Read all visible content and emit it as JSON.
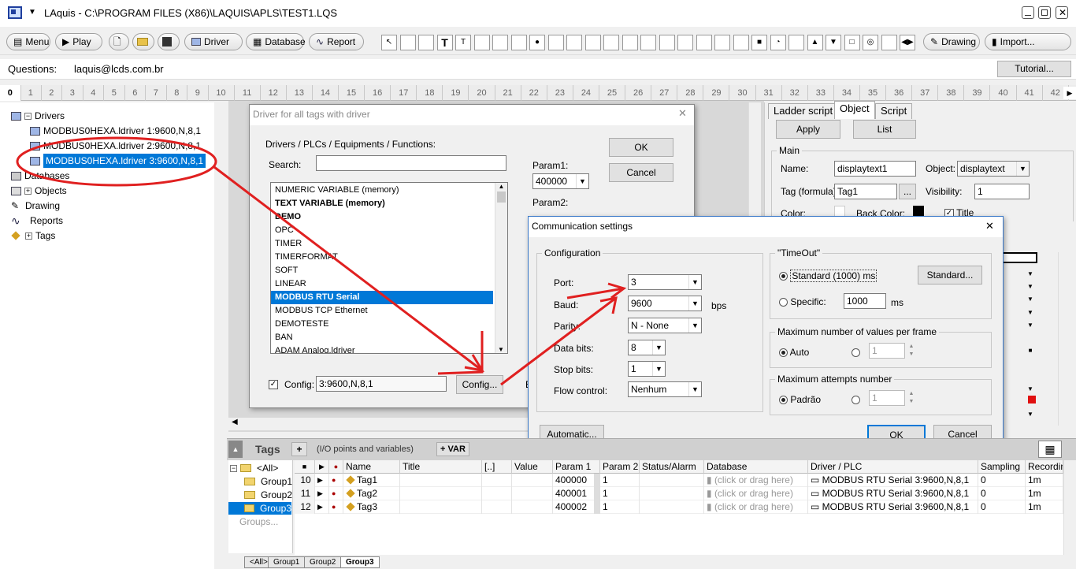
{
  "window": {
    "title": "LAquis - C:\\PROGRAM FILES (X86)\\LAQUIS\\APLS\\TEST1.LQS"
  },
  "toolbar": {
    "menu": "Menu",
    "play": "Play",
    "driver": "Driver",
    "database": "Database",
    "report": "Report",
    "drawing": "Drawing",
    "import": "Import...",
    "icons": [
      "cursor-tool",
      "image-tool",
      "display-tool",
      "text-tool",
      "small-text-tool",
      "button-tool",
      "graph-tool",
      "line-chart-tool",
      "led-tool",
      "switch-tool",
      "panel-tool",
      "alarm-tool",
      "display-panel-tool",
      "bar-tool",
      "valve-tool",
      "lamp-tool",
      "rectangle-tool",
      "chart-tool",
      "bottle-tool",
      "scale-tool",
      "color-tool",
      "gauge-tool",
      "tank-tool",
      "spin-tool",
      "combo-tool",
      "square-tool",
      "dial-tool",
      "frame-tool",
      "arrows-tool"
    ]
  },
  "questions": {
    "label": "Questions:",
    "email": "laquis@lcds.com.br",
    "tutorial": "Tutorial..."
  },
  "ruler": [
    "0",
    "1",
    "2",
    "3",
    "4",
    "5",
    "6",
    "7",
    "8",
    "9",
    "10",
    "11",
    "12",
    "13",
    "14",
    "15",
    "16",
    "17",
    "18",
    "19",
    "20",
    "21",
    "22",
    "23",
    "24",
    "25",
    "26",
    "27",
    "28",
    "29",
    "30",
    "31",
    "32",
    "33",
    "34",
    "35",
    "36",
    "37",
    "38",
    "39",
    "40",
    "41",
    "42"
  ],
  "tree": {
    "drivers": "Drivers",
    "driver_items": [
      "MODBUS0HEXA.ldriver   1:9600,N,8,1",
      "MODBUS0HEXA.ldriver   2:9600,N,8,1",
      "MODBUS0HEXA.ldriver   3:9600,N,8,1"
    ],
    "databases": "Databases",
    "objects": "Objects",
    "drawing": "Drawing",
    "reports": "Reports",
    "tags": "Tags"
  },
  "driver_dialog": {
    "title": "Driver for all tags with driver",
    "heading": "Drivers / PLCs / Equipments / Functions:",
    "search_label": "Search:",
    "search_value": "",
    "ok": "OK",
    "cancel": "Cancel",
    "param1_label": "Param1:",
    "param1_value": "400000",
    "param2_label": "Param2:",
    "items": [
      "NUMERIC VARIABLE (memory)",
      "TEXT VARIABLE (memory)",
      "DEMO",
      "OPC",
      "TIMER",
      "TIMERFORMAT",
      "SOFT",
      "LINEAR",
      "MODBUS RTU Serial",
      "MODBUS TCP Ethernet",
      "DEMOTESTE",
      "BAN",
      "ADAM Analog.ldriver"
    ],
    "config_label": "Config:",
    "config_value": "3:9600,N,8,1",
    "config_button": "Config...",
    "e_label": "E"
  },
  "comm_dialog": {
    "title": "Communication settings",
    "config_group": "Configuration",
    "port_label": "Port:",
    "port_value": "3",
    "baud_label": "Baud:",
    "baud_value": "9600",
    "bps": "bps",
    "parity_label": "Parity:",
    "parity_value": "N - None",
    "databits_label": "Data bits:",
    "databits_value": "8",
    "stopbits_label": "Stop bits:",
    "stopbits_value": "1",
    "flow_label": "Flow control:",
    "flow_value": "Nenhum",
    "timeout_group": "\"TimeOut\"",
    "standard_radio": "Standard (1000) ms",
    "standard_button": "Standard...",
    "specific_label": "Specific:",
    "specific_value": "1000",
    "ms": "ms",
    "maxvalues_group": "Maximum number of values per frame",
    "auto_label": "Auto",
    "maxvalues_value": "1",
    "maxattempts_group": "Maximum attempts number",
    "padrao_label": "Padrão",
    "maxattempts_value": "1",
    "automatic": "Automatic...",
    "ok": "OK",
    "cancel": "Cancel"
  },
  "right_panel": {
    "tabs": [
      "Ladder script",
      "Object",
      "Script"
    ],
    "apply": "Apply",
    "list": "List",
    "main_group": "Main",
    "name_label": "Name:",
    "name_value": "displaytext1",
    "object_label": "Object:",
    "object_value": "displaytext",
    "tag_label": "Tag (formula):",
    "tag_value": "Tag1",
    "tag_button": "...",
    "visibility_label": "Visibility:",
    "visibility_value": "1",
    "color_label": "Color:",
    "backcolor_label": "Back Color:",
    "title_label": "Title"
  },
  "tags_panel": {
    "title": "Tags",
    "plus": "+",
    "subtitle": "(I/O points and variables)",
    "add_var": "+ VAR",
    "groups": [
      "<All>",
      "Group1",
      "Group2",
      "Group3",
      "Groups..."
    ],
    "columns": [
      "Name",
      "Title",
      "[..]",
      "Value",
      "Param 1",
      "Param 2",
      "Status/Alarm",
      "Database",
      "Driver / PLC",
      "Sampling",
      "Recording"
    ],
    "rows": [
      {
        "num": "10",
        "name": "Tag1",
        "param1": "400000",
        "param2": "1",
        "database": "(click or drag here)",
        "driver": "MODBUS RTU Serial 3:9600,N,8,1",
        "sampling": "0",
        "recording": "1m"
      },
      {
        "num": "11",
        "name": "Tag2",
        "param1": "400001",
        "param2": "1",
        "database": "(click or drag here)",
        "driver": "MODBUS RTU Serial 3:9600,N,8,1",
        "sampling": "0",
        "recording": "1m"
      },
      {
        "num": "12",
        "name": "Tag3",
        "param1": "400002",
        "param2": "1",
        "database": "(click or drag here)",
        "driver": "MODBUS RTU Serial 3:9600,N,8,1",
        "sampling": "0",
        "recording": "1m"
      }
    ],
    "bottom_tabs": [
      "<All>",
      "Group1",
      "Group2",
      "Group3"
    ]
  },
  "colors": {
    "selection": "#0078d7",
    "annotation": "#e02020"
  }
}
